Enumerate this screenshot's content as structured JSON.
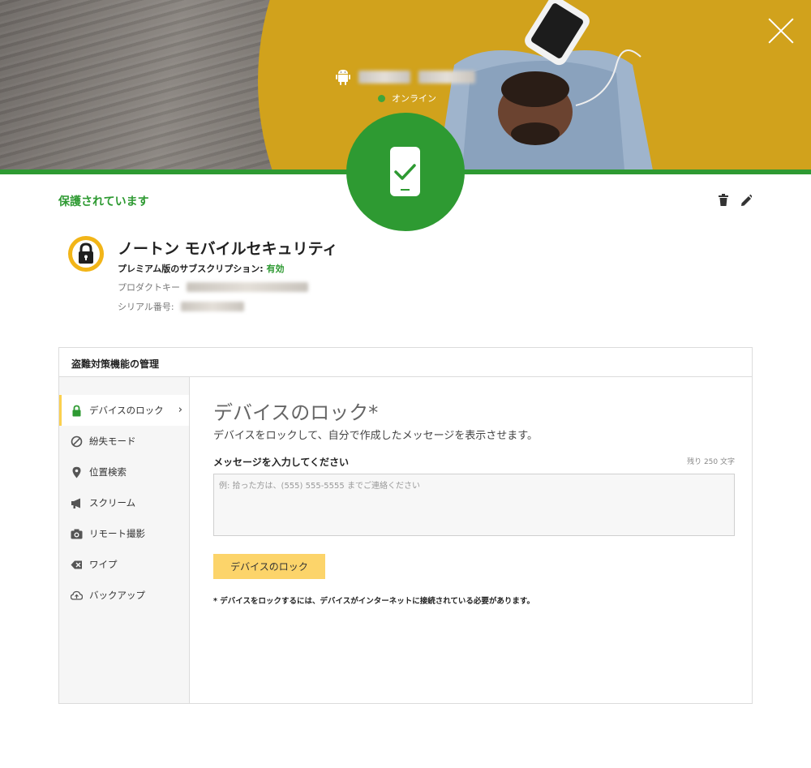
{
  "colors": {
    "brand_green": "#2e9a32",
    "accent_yellow": "#fcd46a",
    "sun_yellow": "#d1a21c"
  },
  "header": {
    "device_icon": "android-icon",
    "device_name": "",
    "status_text": "オンライン",
    "close_icon": "close-icon",
    "status_badge_icon": "phone-check-icon"
  },
  "product": {
    "protection_status": "保護されています",
    "title": "ノートン モバイルセキュリティ",
    "subscription_label": "プレミアム版のサブスクリプション:",
    "subscription_value": "有効",
    "product_key_label": "プロダクトキー",
    "serial_label": "シリアル番号:",
    "actions": [
      {
        "icon": "trash-icon"
      },
      {
        "icon": "pencil-icon"
      }
    ]
  },
  "panel": {
    "header": "盗難対策機能の管理",
    "sidebar": [
      {
        "label": "デバイスのロック",
        "icon": "lock-icon",
        "active": true
      },
      {
        "label": "紛失モード",
        "icon": "prohibited-icon"
      },
      {
        "label": "位置検索",
        "icon": "location-pin-icon"
      },
      {
        "label": "スクリーム",
        "icon": "megaphone-icon"
      },
      {
        "label": "リモート撮影",
        "icon": "camera-icon"
      },
      {
        "label": "ワイプ",
        "icon": "erase-icon"
      },
      {
        "label": "バックアップ",
        "icon": "cloud-backup-icon"
      }
    ],
    "content": {
      "title": "デバイスのロック*",
      "description": "デバイスをロックして、自分で作成したメッセージを表示させます。",
      "message_label": "メッセージを入力してください",
      "char_count": "残り 250 文字",
      "message_value": "",
      "message_placeholder": "例: 拾った方は、(555) 555-5555 までご連絡ください",
      "button_label": "デバイスのロック",
      "note": "* デバイスをロックするには、デバイスがインターネットに接続されている必要があります。"
    }
  }
}
